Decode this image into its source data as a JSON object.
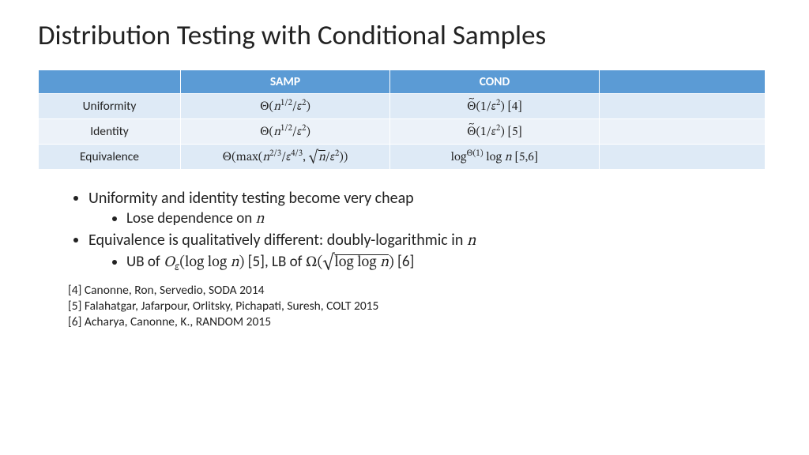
{
  "title": "Distribution Testing with Conditional Samples",
  "table": {
    "headers": [
      "",
      "SAMP",
      "COND",
      ""
    ],
    "rows": [
      {
        "label": "Uniformity",
        "samp_html": "<span class='theta'></span>(<span class='ital'>n</span><sup>1/2</sup>/<span class='eps'></span><sup>2</sup>)",
        "cond_html": "<span class='tilde-over'><span class='theta'></span></span>(1/<span class='eps'></span><sup>2</sup>) [4]"
      },
      {
        "label": "Identity",
        "samp_html": "<span class='theta'></span>(<span class='ital'>n</span><sup>1/2</sup>/<span class='eps'></span><sup>2</sup>)",
        "cond_html": "<span class='tilde-over'><span class='theta'></span></span>(1/<span class='eps'></span><sup>2</sup>) [5]"
      },
      {
        "label": "Equivalence",
        "samp_html": "<span class='theta'></span>(max(<span class='ital'>n</span><sup>2/3</sup>/<span class='eps'></span><sup>4/3</sup>, √<span class='sqrt'><span class='ital'>n</span></span>/<span class='eps'></span><sup>2</sup>))",
        "cond_html": "log<sup><span class='theta'></span>(1)</sup> log <span class='ital'>n</span> [5,6]"
      }
    ]
  },
  "bullets": {
    "b1": "Uniformity and identity testing become very cheap",
    "b1a_html": "Lose dependence on <span class='math ital'>n</span>",
    "b2_html": "Equivalence is qualitatively different: doubly-logarithmic in <span class='math ital'>n</span>",
    "b2a_html": "UB of <span class='math'><span class='ital'>O</span><sub><span class='eps'></span></sub>(log log <span class='ital'>n</span>)</span> [5], LB of <span class='math'><span class='Omega'></span>(√<span class='sqrt'>log log <span class='ital'>n</span></span>)</span> [6]"
  },
  "refs": {
    "r4": "[4] Canonne, Ron, Servedio, SODA 2014",
    "r5": "[5] Falahatgar, Jafarpour, Orlitsky, Pichapati, Suresh, COLT 2015",
    "r6": "[6] Acharya, Canonne, K., RANDOM 2015"
  }
}
